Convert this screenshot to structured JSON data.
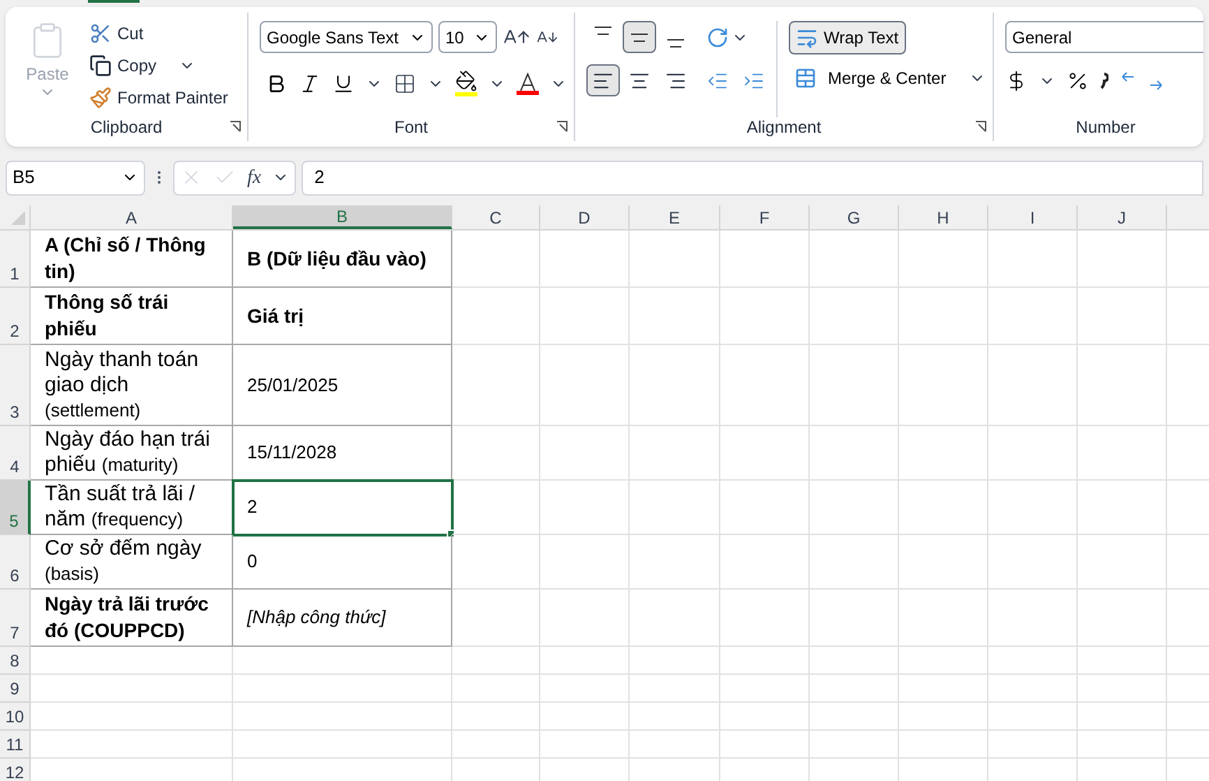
{
  "ribbon": {
    "clipboard": {
      "label": "Clipboard",
      "paste": "Paste",
      "cut": "Cut",
      "copy": "Copy",
      "format_painter": "Format Painter"
    },
    "font": {
      "label": "Font",
      "font_name": "Google Sans Text",
      "font_size": "10"
    },
    "alignment": {
      "label": "Alignment",
      "vertical": [
        {
          "selected": false
        },
        {
          "selected": true
        },
        {
          "selected": false
        }
      ],
      "horizontal": [
        {
          "selected": true
        },
        {
          "selected": false
        },
        {
          "selected": false
        }
      ],
      "wrap_text": {
        "label": "Wrap Text",
        "selected": true
      },
      "merge": "Merge & Center"
    },
    "number": {
      "label": "Number",
      "format": "General"
    }
  },
  "formula_bar": {
    "name_box": "B5",
    "fx": "fx",
    "formula": "2"
  },
  "columns": [
    {
      "label": "A",
      "selected": false
    },
    {
      "label": "B",
      "selected": true
    },
    {
      "label": "C",
      "selected": false
    },
    {
      "label": "D",
      "selected": false
    },
    {
      "label": "E",
      "selected": false
    },
    {
      "label": "F",
      "selected": false
    },
    {
      "label": "G",
      "selected": false
    },
    {
      "label": "H",
      "selected": false
    },
    {
      "label": "I",
      "selected": false
    },
    {
      "label": "J",
      "selected": false
    }
  ],
  "rows": [
    {
      "number": "1",
      "selected": false,
      "cells": [
        {
          "text": "A (Chỉ số / Thông tin)",
          "bold": true,
          "italic": false,
          "selected": false
        },
        {
          "text": "B (Dữ liệu đầu vào)",
          "bold": true,
          "italic": false,
          "selected": false
        }
      ]
    },
    {
      "number": "2",
      "selected": false,
      "cells": [
        {
          "text": "Thông số trái phiếu",
          "bold": true,
          "italic": false,
          "selected": false
        },
        {
          "text": "Giá trị",
          "bold": true,
          "italic": false,
          "selected": false
        }
      ]
    },
    {
      "number": "3",
      "selected": false,
      "cells": [
        {
          "text": "Ngày thanh toán giao dịch",
          "note": "(settlement)",
          "bold": false,
          "italic": false,
          "selected": false
        },
        {
          "text": "25/01/2025",
          "bold": false,
          "italic": false,
          "selected": false
        }
      ]
    },
    {
      "number": "4",
      "selected": false,
      "cells": [
        {
          "text": "Ngày đáo hạn trái phiếu",
          "note": "(maturity)",
          "bold": false,
          "italic": false,
          "selected": false
        },
        {
          "text": "15/11/2028",
          "bold": false,
          "italic": false,
          "selected": false
        }
      ]
    },
    {
      "number": "5",
      "selected": true,
      "cells": [
        {
          "text": "Tần suất trả lãi / năm",
          "note": "(frequency)",
          "bold": false,
          "italic": false,
          "selected": false
        },
        {
          "text": "2",
          "bold": false,
          "italic": false,
          "selected": true
        }
      ]
    },
    {
      "number": "6",
      "selected": false,
      "cells": [
        {
          "text": "Cơ sở đếm ngày",
          "note": "(basis)",
          "bold": false,
          "italic": false,
          "selected": false
        },
        {
          "text": "0",
          "bold": false,
          "italic": false,
          "selected": false
        }
      ]
    },
    {
      "number": "7",
      "selected": false,
      "cells": [
        {
          "text": "Ngày trả lãi trước đó (COUPPCD)",
          "bold": true,
          "italic": false,
          "selected": false
        },
        {
          "text": "[Nhập công thức]",
          "bold": false,
          "italic": true,
          "selected": false
        }
      ]
    },
    {
      "number": "8",
      "selected": false,
      "cells": []
    },
    {
      "number": "9",
      "selected": false,
      "cells": []
    },
    {
      "number": "10",
      "selected": false,
      "cells": []
    },
    {
      "number": "11",
      "selected": false,
      "cells": []
    },
    {
      "number": "12",
      "selected": false,
      "cells": []
    }
  ]
}
